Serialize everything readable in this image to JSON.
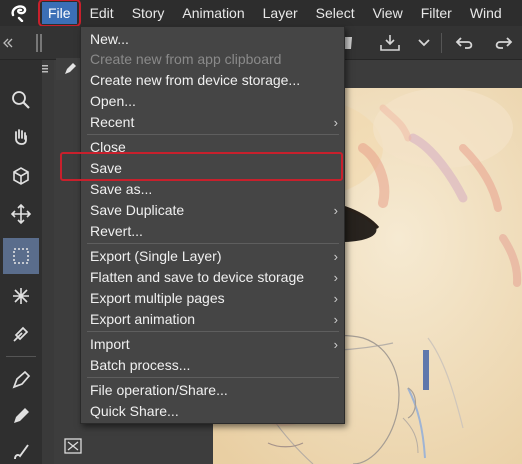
{
  "menubar": {
    "items": [
      "File",
      "Edit",
      "Story",
      "Animation",
      "Layer",
      "Select",
      "View",
      "Filter",
      "Wind"
    ]
  },
  "file_menu": {
    "items": [
      {
        "label": "New...",
        "enabled": true,
        "submenu": false
      },
      {
        "label": "Create new from app clipboard",
        "enabled": false,
        "submenu": false
      },
      {
        "label": "Create new from device storage...",
        "enabled": true,
        "submenu": false
      },
      {
        "label": "Open...",
        "enabled": true,
        "submenu": false
      },
      {
        "label": "Recent",
        "enabled": true,
        "submenu": true
      },
      {
        "label": "Close",
        "enabled": true,
        "submenu": false
      },
      {
        "label": "Save",
        "enabled": true,
        "submenu": false,
        "highlighted": true
      },
      {
        "label": "Save as...",
        "enabled": true,
        "submenu": false
      },
      {
        "label": "Save Duplicate",
        "enabled": true,
        "submenu": true
      },
      {
        "label": "Revert...",
        "enabled": true,
        "submenu": false
      },
      {
        "label": "Export (Single Layer)",
        "enabled": true,
        "submenu": true
      },
      {
        "label": "Flatten and save to device storage",
        "enabled": true,
        "submenu": true
      },
      {
        "label": "Export multiple pages",
        "enabled": true,
        "submenu": true
      },
      {
        "label": "Export animation",
        "enabled": true,
        "submenu": true
      },
      {
        "label": "Import",
        "enabled": true,
        "submenu": true
      },
      {
        "label": "Batch process...",
        "enabled": true,
        "submenu": false
      },
      {
        "label": "File operation/Share...",
        "enabled": true,
        "submenu": false
      },
      {
        "label": "Quick Share...",
        "enabled": true,
        "submenu": false
      }
    ],
    "submenu_arrow": "›"
  },
  "colors": {
    "accent": "#3b6fb6",
    "highlight_outline": "#c8202c",
    "menu_bg": "#454545"
  },
  "icons": [
    "app-logo-icon",
    "collapse-icon",
    "grip-icon",
    "menu-icon",
    "pen-icon",
    "zoom-icon",
    "hand-icon",
    "operation-icon",
    "move-icon",
    "selection-icon",
    "auto-select-icon",
    "eyedropper-icon",
    "pen-tool-icon",
    "pencil-tool-icon",
    "brush-tool-icon",
    "fill-icon",
    "download-icon",
    "undo-icon",
    "redo-icon"
  ]
}
